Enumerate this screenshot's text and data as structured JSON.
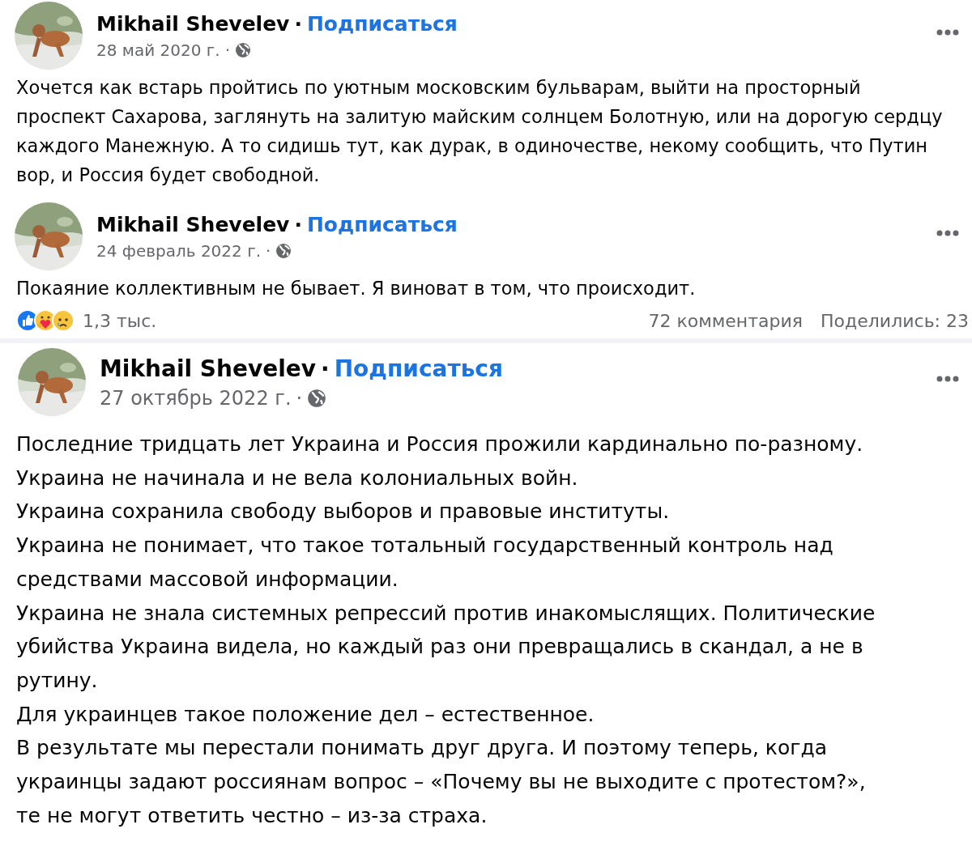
{
  "posts": [
    {
      "kind": "compact",
      "author": "Mikhail Shevelev",
      "separator": "·",
      "follow": "Подписаться",
      "date": "28 май 2020 г.",
      "date_separator": "·",
      "lines": [
        "Хочется как встарь пройтись по уютным московским бульварам, выйти на просторный",
        "проспект Сахарова, заглянуть на залитую майским солнцем Болотную, или на дорогую сердцу",
        "каждого Манежную. А то сидишь тут, как дурак, в одиночестве, некому сообщить, что Путин",
        "вор, и Россия будет свободной."
      ]
    },
    {
      "kind": "compact",
      "author": "Mikhail Shevelev",
      "separator": "·",
      "follow": "Подписаться",
      "date": "24 февраль 2022 г.",
      "date_separator": "·",
      "lines": [
        "Покаяние коллективным не бывает. Я виноват в том, что происходит."
      ],
      "footer": {
        "reactions_count": "1,3 тыс.",
        "comments": "72 комментария",
        "shares": "Поделились: 23"
      }
    },
    {
      "kind": "large",
      "author": "Mikhail Shevelev",
      "separator": "·",
      "follow": "Подписаться",
      "date": "27 октябрь 2022 г.",
      "date_separator": "·",
      "lines": [
        "Последние тридцать лет Украина и Россия прожили кардинально по-разному.",
        "Украина не начинала и не вела колониальных войн.",
        "Украина сохранила свободу выборов и правовые институты.",
        "Украина не понимает, что такое тотальный государственный контроль над",
        "средствами массовой информации.",
        "Украина не знала системных репрессий против инакомыслящих. Политические",
        "убийства Украина видела, но каждый раз они превращались в скандал, а не в",
        "рутину.",
        "Для украинцев такое положение дел – естественное.",
        "В результате мы перестали понимать друг друга. И поэтому теперь, когда",
        "украинцы задают россиянам вопрос – «Почему вы не выходите с протестом?»,",
        "те не могут ответить честно – из-за страха."
      ]
    }
  ]
}
